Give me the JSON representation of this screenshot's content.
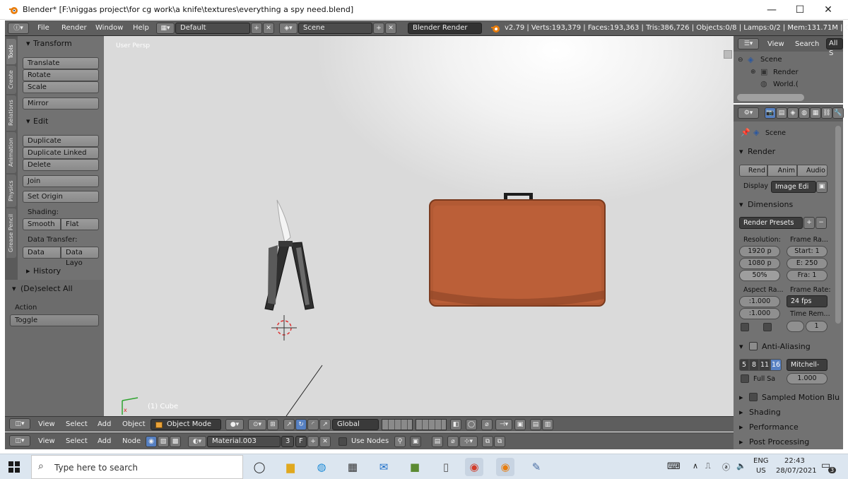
{
  "window": {
    "title": "Blender* [F:\\niggas project\\for cg work\\a knife\\textures\\everything a spy need.blend]",
    "minimize": "—",
    "maximize": "☐",
    "close": "✕"
  },
  "infobar": {
    "menus": [
      "File",
      "Render",
      "Window",
      "Help"
    ],
    "layout": "Default",
    "scene": "Scene",
    "engine": "Blender Render",
    "stats": "v2.79 | Verts:193,379 | Faces:193,363 | Tris:386,726 | Objects:0/8 | Lamps:0/2 | Mem:131.71M | Cube"
  },
  "tools": {
    "tabs": [
      "Tools",
      "Create",
      "Relations",
      "Animation",
      "Physics",
      "Grease Pencil"
    ],
    "transform": {
      "heading": "Transform",
      "buttons": [
        "Translate",
        "Rotate",
        "Scale"
      ],
      "mirror": "Mirror"
    },
    "edit": {
      "heading": "Edit",
      "buttons": [
        "Duplicate",
        "Duplicate Linked",
        "Delete"
      ],
      "join": "Join",
      "set_origin": "Set Origin",
      "shading_label": "Shading:",
      "smooth": "Smooth",
      "flat": "Flat",
      "data_transfer_label": "Data Transfer:",
      "data": "Data",
      "data_layout": "Data Layo"
    },
    "history": "History",
    "operator": {
      "heading": "(De)select All",
      "action_label": "Action",
      "action_value": "Toggle"
    }
  },
  "viewport": {
    "corner_label": "User Persp",
    "object_label": "(1) Cube"
  },
  "view3d_header": {
    "view": "View",
    "select": "Select",
    "add": "Add",
    "object": "Object",
    "mode": "Object Mode",
    "orientation": "Global"
  },
  "node_header": {
    "view": "View",
    "select": "Select",
    "add": "Add",
    "node": "Node",
    "material": "Material.003",
    "users": "3",
    "fake": "F",
    "use_nodes": "Use Nodes"
  },
  "outliner": {
    "view": "View",
    "search": "Search",
    "all": "All S",
    "items": [
      "Scene",
      "Render",
      "World.("
    ]
  },
  "properties": {
    "scene": "Scene",
    "render": {
      "heading": "Render",
      "render_btn": "Rend",
      "anim_btn": "Anim",
      "audio_btn": "Audio",
      "display_label": "Display",
      "display_value": "Image Edi"
    },
    "dimensions": {
      "heading": "Dimensions",
      "presets": "Render Presets",
      "resolution_label": "Resolution:",
      "res_x": "1920 p",
      "res_y": "1080 p",
      "res_pct": "50%",
      "frame_range_label": "Frame Ra...",
      "start": "Start: 1",
      "end": "E:  250",
      "step": "Fra:   1",
      "aspect_label": "Aspect Ra...",
      "aspect_x": ":1.000",
      "aspect_y": ":1.000",
      "frame_rate_label": "Frame Rate:",
      "fps": "24 fps",
      "time_remap_label": "Time Rem...",
      "time_remap": "1"
    },
    "antialiasing": {
      "heading": "Anti-Aliasing",
      "samples": [
        "5",
        "8",
        "11",
        "16"
      ],
      "filter": "Mitchell-",
      "full_sample": "Full Sa",
      "filter_size": "1.000"
    },
    "collapsed": [
      "Sampled Motion Blu",
      "Shading",
      "Performance",
      "Post Processing"
    ]
  },
  "taskbar": {
    "search_placeholder": "Type here to search",
    "lang1": "ENG",
    "lang2": "US",
    "time": "22:43",
    "date": "28/07/2021",
    "notif": "3"
  }
}
